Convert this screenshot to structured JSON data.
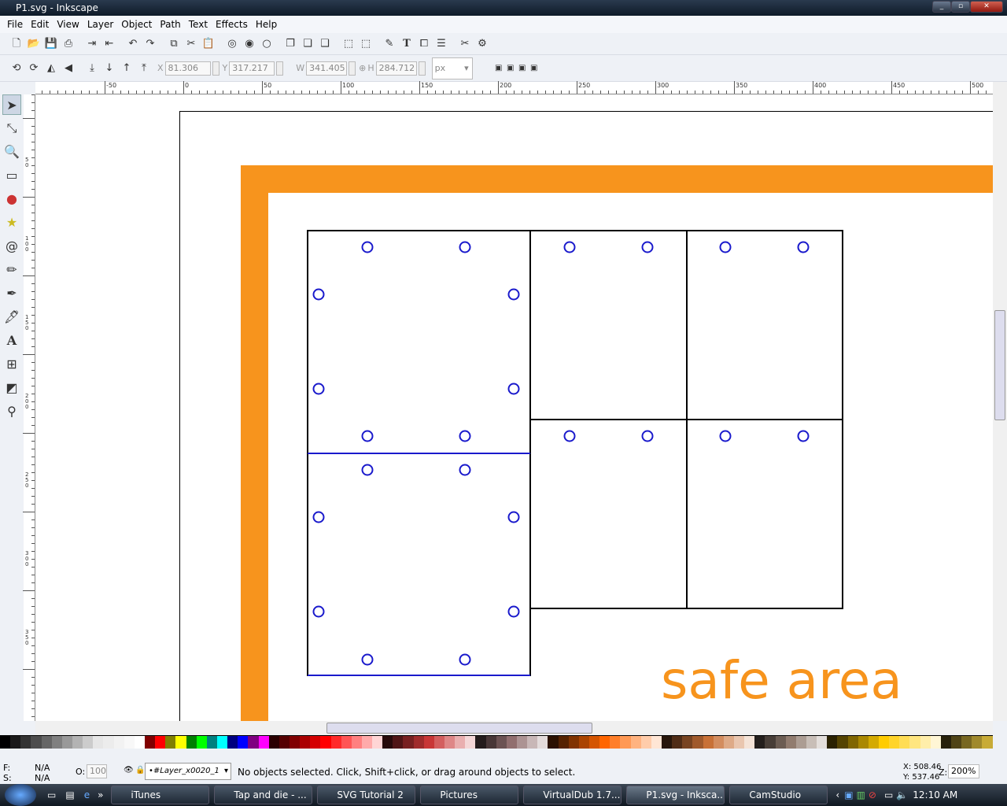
{
  "window": {
    "title": "P1.svg - Inkscape"
  },
  "menu": [
    "File",
    "Edit",
    "View",
    "Layer",
    "Object",
    "Path",
    "Text",
    "Effects",
    "Help"
  ],
  "toolbar": {
    "x_label": "X",
    "x": "81.306",
    "y_label": "Y",
    "y": "317.217",
    "w_label": "W",
    "w": "341.405",
    "h_label": "H",
    "h": "284.712",
    "unit": "px"
  },
  "ruler_top": [
    "-50",
    "0",
    "50",
    "100",
    "150",
    "200",
    "250",
    "300",
    "350",
    "400",
    "450",
    "500"
  ],
  "ruler_left": [
    "50",
    "100",
    "150",
    "200",
    "250",
    "300",
    "350"
  ],
  "canvas": {
    "safe_label": "safe area",
    "accent": "#f7941d",
    "hole_color": "#1a1acc"
  },
  "palette": [
    "#000000",
    "#1a1a1a",
    "#333333",
    "#4d4d4d",
    "#666666",
    "#808080",
    "#999999",
    "#b3b3b3",
    "#cccccc",
    "#e6e6e6",
    "#ececec",
    "#f2f2f2",
    "#f8f8f8",
    "#ffffff",
    "#800000",
    "#ff0000",
    "#808000",
    "#ffff00",
    "#008000",
    "#00ff00",
    "#008080",
    "#00ffff",
    "#000080",
    "#0000ff",
    "#800080",
    "#ff00ff",
    "#2b0000",
    "#550000",
    "#800000",
    "#aa0000",
    "#d40000",
    "#ff0000",
    "#ff2a2a",
    "#ff5555",
    "#ff8080",
    "#ffaaaa",
    "#ffd5d5",
    "#280b0b",
    "#501616",
    "#782121",
    "#a02c2c",
    "#c83737",
    "#d35f5f",
    "#de8787",
    "#e9afaf",
    "#f4d7d7",
    "#241c1c",
    "#483737",
    "#6c5353",
    "#916f6f",
    "#ac9393",
    "#c8b7b7",
    "#e3dbdb",
    "#2b1100",
    "#552200",
    "#803300",
    "#aa4400",
    "#d45500",
    "#ff6600",
    "#ff7f2a",
    "#ff9955",
    "#ffb380",
    "#ffccaa",
    "#ffe6d5",
    "#28170b",
    "#502d16",
    "#784421",
    "#a05a2c",
    "#c87137",
    "#d38d5f",
    "#deaa87",
    "#e9c6af",
    "#f4e3d7",
    "#241f1c",
    "#483e37",
    "#6c5d53",
    "#917c6f",
    "#ac9d93",
    "#c8beb7",
    "#e3dedb",
    "#2b2200",
    "#554400",
    "#806600",
    "#aa8800",
    "#d4aa00",
    "#ffcc00",
    "#ffd42a",
    "#ffdd55",
    "#ffe680",
    "#ffeeaa",
    "#fff6d5",
    "#28220b",
    "#504416",
    "#786721",
    "#a0892c",
    "#c8ab37"
  ],
  "status": {
    "fill_label": "F:",
    "fill": "N/A",
    "stroke_label": "S:",
    "stroke": "N/A",
    "opacity_label": "O:",
    "opacity": "100",
    "layer": "•#Layer_x0020_1",
    "message": "No objects selected. Click, Shift+click, or drag around objects to select.",
    "cursor_x": "X: 508.46",
    "cursor_y": "Y: 537.46",
    "zoom_label": "Z:",
    "zoom": "200%"
  },
  "taskbar": {
    "items": [
      "iTunes",
      "Tap and die - ...",
      "SVG Tutorial 2",
      "Pictures",
      "VirtualDub 1.7....",
      "P1.svg - Inksca...",
      "CamStudio"
    ],
    "active": 5,
    "clock": "12:10 AM"
  }
}
